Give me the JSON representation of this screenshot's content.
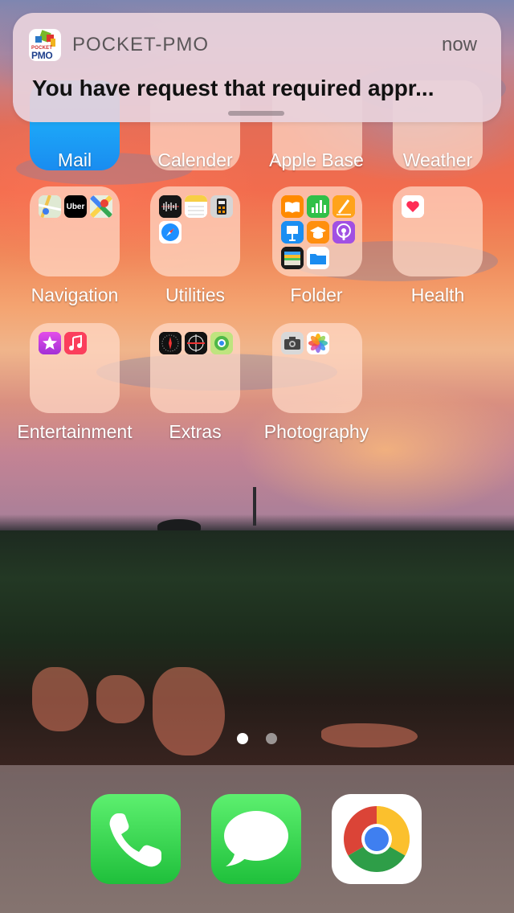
{
  "notification": {
    "app_name": "POCKET-PMO",
    "time": "now",
    "message": "You have request that required appr...",
    "icon_text_small": "POCKET",
    "icon_text_big": "PMO"
  },
  "home": {
    "apps": [
      {
        "label": "Mail"
      },
      {
        "label": "Calender"
      },
      {
        "label": "Apple Base"
      },
      {
        "label": "Weather"
      },
      {
        "label": "Navigation",
        "contains": [
          "maps-icon",
          "uber-icon",
          "google-maps-icon"
        ]
      },
      {
        "label": "Utilities",
        "contains": [
          "voice-memos-icon",
          "notes-icon",
          "calculator-icon",
          "safari-icon"
        ]
      },
      {
        "label": "Folder",
        "contains": [
          "books-icon",
          "numbers-icon",
          "pages-icon",
          "keynote-icon",
          "itunes-u-icon",
          "podcasts-icon",
          "wallet-icon",
          "files-icon"
        ]
      },
      {
        "label": "Health",
        "contains": [
          "health-icon"
        ]
      },
      {
        "label": "Entertainment",
        "contains": [
          "itunes-store-icon",
          "music-icon"
        ]
      },
      {
        "label": "Extras",
        "contains": [
          "compass-icon",
          "measure-icon",
          "find-my-icon"
        ]
      },
      {
        "label": "Photography",
        "contains": [
          "camera-icon",
          "photos-icon"
        ]
      }
    ],
    "uber_label": "Uber",
    "page_dots": {
      "count": 2,
      "active": 1
    }
  },
  "dock": {
    "apps": [
      "phone-icon",
      "messages-icon",
      "chrome-icon"
    ]
  },
  "colors": {
    "phone_green": "#29c94a",
    "messages_green": "#2fd14f",
    "notification_bg": "#e8d2dc"
  }
}
